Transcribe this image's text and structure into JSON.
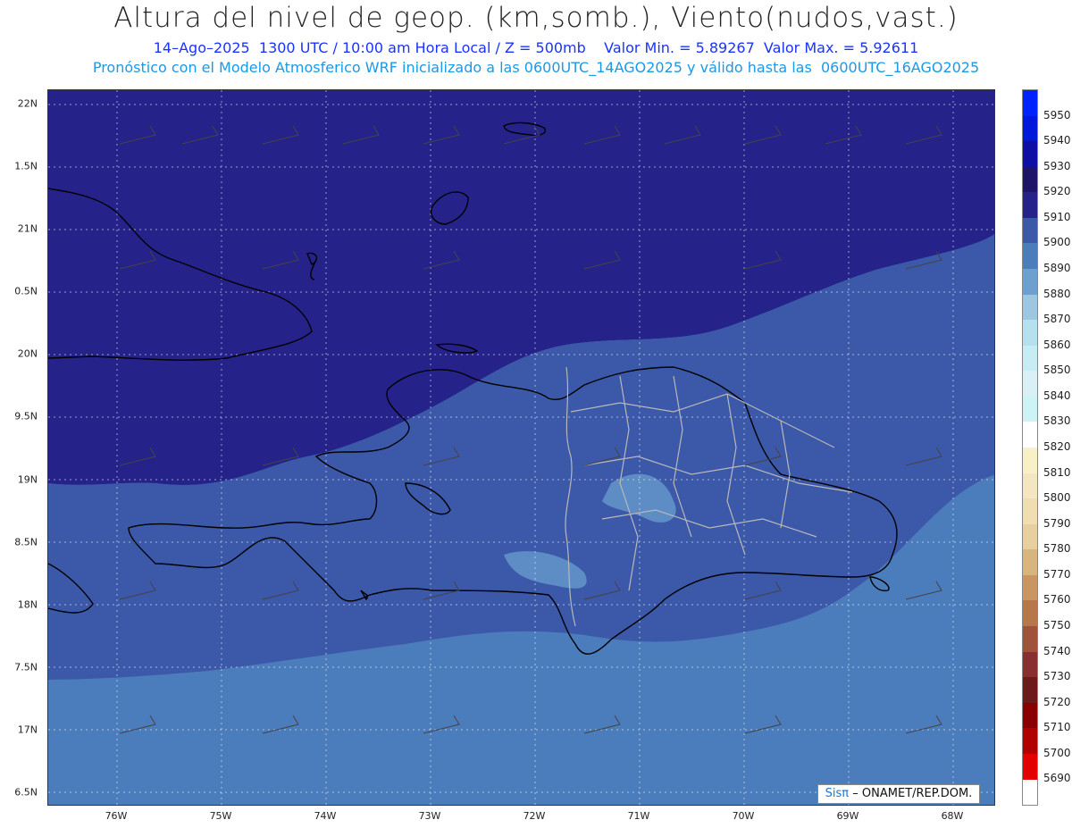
{
  "header": {
    "title": "Altura del nivel de geop. (km,somb.), Viento(nudos,vast.)",
    "subtitle1": "14–Ago–2025  1300 UTC / 10:00 am Hora Local / Z = 500mb    Valor Min. = 5.89267  Valor Max. = 5.92611",
    "subtitle2": "Pronóstico con el Modelo Atmosferico WRF inicializado a las 0600UTC_14AGO2025 y válido hasta las  0600UTC_16AGO2025"
  },
  "map": {
    "lat_labels": [
      "22N",
      "1.5N",
      "21N",
      "0.5N",
      "20N",
      "9.5N",
      "19N",
      "8.5N",
      "18N",
      "7.5N",
      "17N",
      "6.5N"
    ],
    "lon_labels": [
      "76W",
      "75W",
      "74W",
      "73W",
      "72W",
      "71W",
      "70W",
      "69W",
      "68W"
    ]
  },
  "legend": {
    "levels": [
      "5950",
      "5940",
      "5930",
      "5920",
      "5910",
      "5900",
      "5890",
      "5880",
      "5870",
      "5860",
      "5850",
      "5840",
      "5830",
      "5820",
      "5810",
      "5800",
      "5790",
      "5780",
      "5770",
      "5760",
      "5750",
      "5740",
      "5730",
      "5720",
      "5710",
      "5700",
      "5690"
    ],
    "colors": [
      "#0022ff",
      "#0018d9",
      "#0f0fa6",
      "#1e1569",
      "#25238a",
      "#3c58a8",
      "#4b7cbb",
      "#6ea0cf",
      "#9dc6e1",
      "#b6e0ee",
      "#c7ecf3",
      "#d9f1f6",
      "#cdf3f7",
      "#ffffff",
      "#faf0c8",
      "#f4e6c0",
      "#f0deb2",
      "#e8cfa0",
      "#d8b47e",
      "#c99563",
      "#b7774b",
      "#a0523a",
      "#8a2f2f",
      "#6e1a1a",
      "#8a0000",
      "#b00000",
      "#e20000"
    ]
  },
  "credit": {
    "sis": "Sisπ",
    "text": "– ONAMET/REP.DOM."
  }
}
